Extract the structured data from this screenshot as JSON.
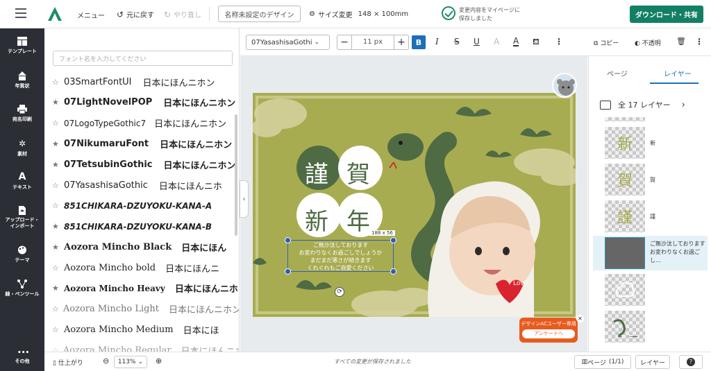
{
  "header": {
    "menu_label": "メニュー",
    "undo_label": "元に戻す",
    "redo_label": "やり直し",
    "design_title": "名称未設定のデザイン",
    "size_label": "サイズ変更",
    "size_value": "148 × 100mm",
    "save_status_line1": "変更内容をマイページに",
    "save_status_line2": "保存しました",
    "download_label": "ダウンロード・共有"
  },
  "sidebar": {
    "items": [
      {
        "label": "テンプレート",
        "icon": "template-icon"
      },
      {
        "label": "年賀状",
        "icon": "newyear-card-icon"
      },
      {
        "label": "宛名印刷",
        "icon": "printer-icon"
      },
      {
        "label": "素材",
        "icon": "material-icon"
      },
      {
        "label": "テキスト",
        "icon": "text-icon"
      },
      {
        "label": "アップロード・インポート",
        "icon": "upload-icon"
      },
      {
        "label": "テーマ",
        "icon": "palette-icon"
      },
      {
        "label": "線・ペンツール",
        "icon": "pen-tool-icon"
      },
      {
        "label": "その他",
        "icon": "more-icon"
      }
    ]
  },
  "font_panel": {
    "search_placeholder": "フォント名を入力してください",
    "fonts": [
      {
        "name": "03SmartFontUI",
        "sample": "日本にほんニホン"
      },
      {
        "name": "07LightNovelPOP",
        "sample": "日本にほんニホン"
      },
      {
        "name": "07LogoTypeGothic7",
        "sample": "日本にほんニホン"
      },
      {
        "name": "07NikumaruFont",
        "sample": "日本にほんニホン"
      },
      {
        "name": "07TetsubinGothic",
        "sample": "日本にほんニホン"
      },
      {
        "name": "07YasashisaGothic",
        "sample": "日本にほんニホ"
      },
      {
        "name": "851CHIKARA-DZUYOKU-KANA-A",
        "sample": ""
      },
      {
        "name": "851CHIKARA-DZUYOKU-KANA-B",
        "sample": ""
      },
      {
        "name": "Aozora Mincho Black",
        "sample": "日本にほん"
      },
      {
        "name": "Aozora Mincho bold",
        "sample": "日本にほんニ"
      },
      {
        "name": "Aozora Mincho Heavy",
        "sample": "日本にほんニホ"
      },
      {
        "name": "Aozora Mincho Light",
        "sample": "日本にほんニホン"
      },
      {
        "name": "Aozora Mincho Medium",
        "sample": "日本にほ"
      },
      {
        "name": "Aozora Mincho Regular",
        "sample": "日本にほんニホ"
      }
    ]
  },
  "text_toolbar": {
    "font_name": "07YasashisaGothi",
    "font_size": "11 px",
    "copy_label": "コピー",
    "opacity_label": "不透明"
  },
  "canvas": {
    "greeting_chars": [
      "謹",
      "賀",
      "新",
      "年"
    ],
    "selection_size": "188 x 56",
    "message_lines": [
      "ご無沙汰しております",
      "お変わりなくお過ごしでしょうか",
      "まだまだ寒さが続きます",
      "くれぐれもご自愛ください"
    ],
    "heart_label": "Love",
    "survey_title": "デザインACユーザー専用",
    "survey_button": "アンケートへ"
  },
  "layers_panel": {
    "tab_page": "ページ",
    "tab_layer": "レイヤー",
    "count_label": "全 17 レイヤー",
    "layers": [
      {
        "name": "新",
        "thumb": "新"
      },
      {
        "name": "賀",
        "thumb": "賀"
      },
      {
        "name": "謹",
        "thumb": "謹"
      },
      {
        "name": "ご無沙汰しております お変わりなくお過ごし…",
        "thumb": ""
      },
      {
        "name": "",
        "thumb": ""
      },
      {
        "name": "",
        "thumb": ""
      }
    ]
  },
  "footer": {
    "finish_label": "仕上がり",
    "zoom": "113%",
    "status": "すべての変更が保存されました",
    "page_label": "ページ",
    "page_count": "(1/1)",
    "layer_label": "レイヤー",
    "help_label": "?"
  },
  "colors": {
    "accent": "#137f64",
    "bold_active": "#1d6fb8",
    "card_background": "#a8ac51",
    "snake": "#4e6b44",
    "sidebar": "#2b2e35"
  }
}
